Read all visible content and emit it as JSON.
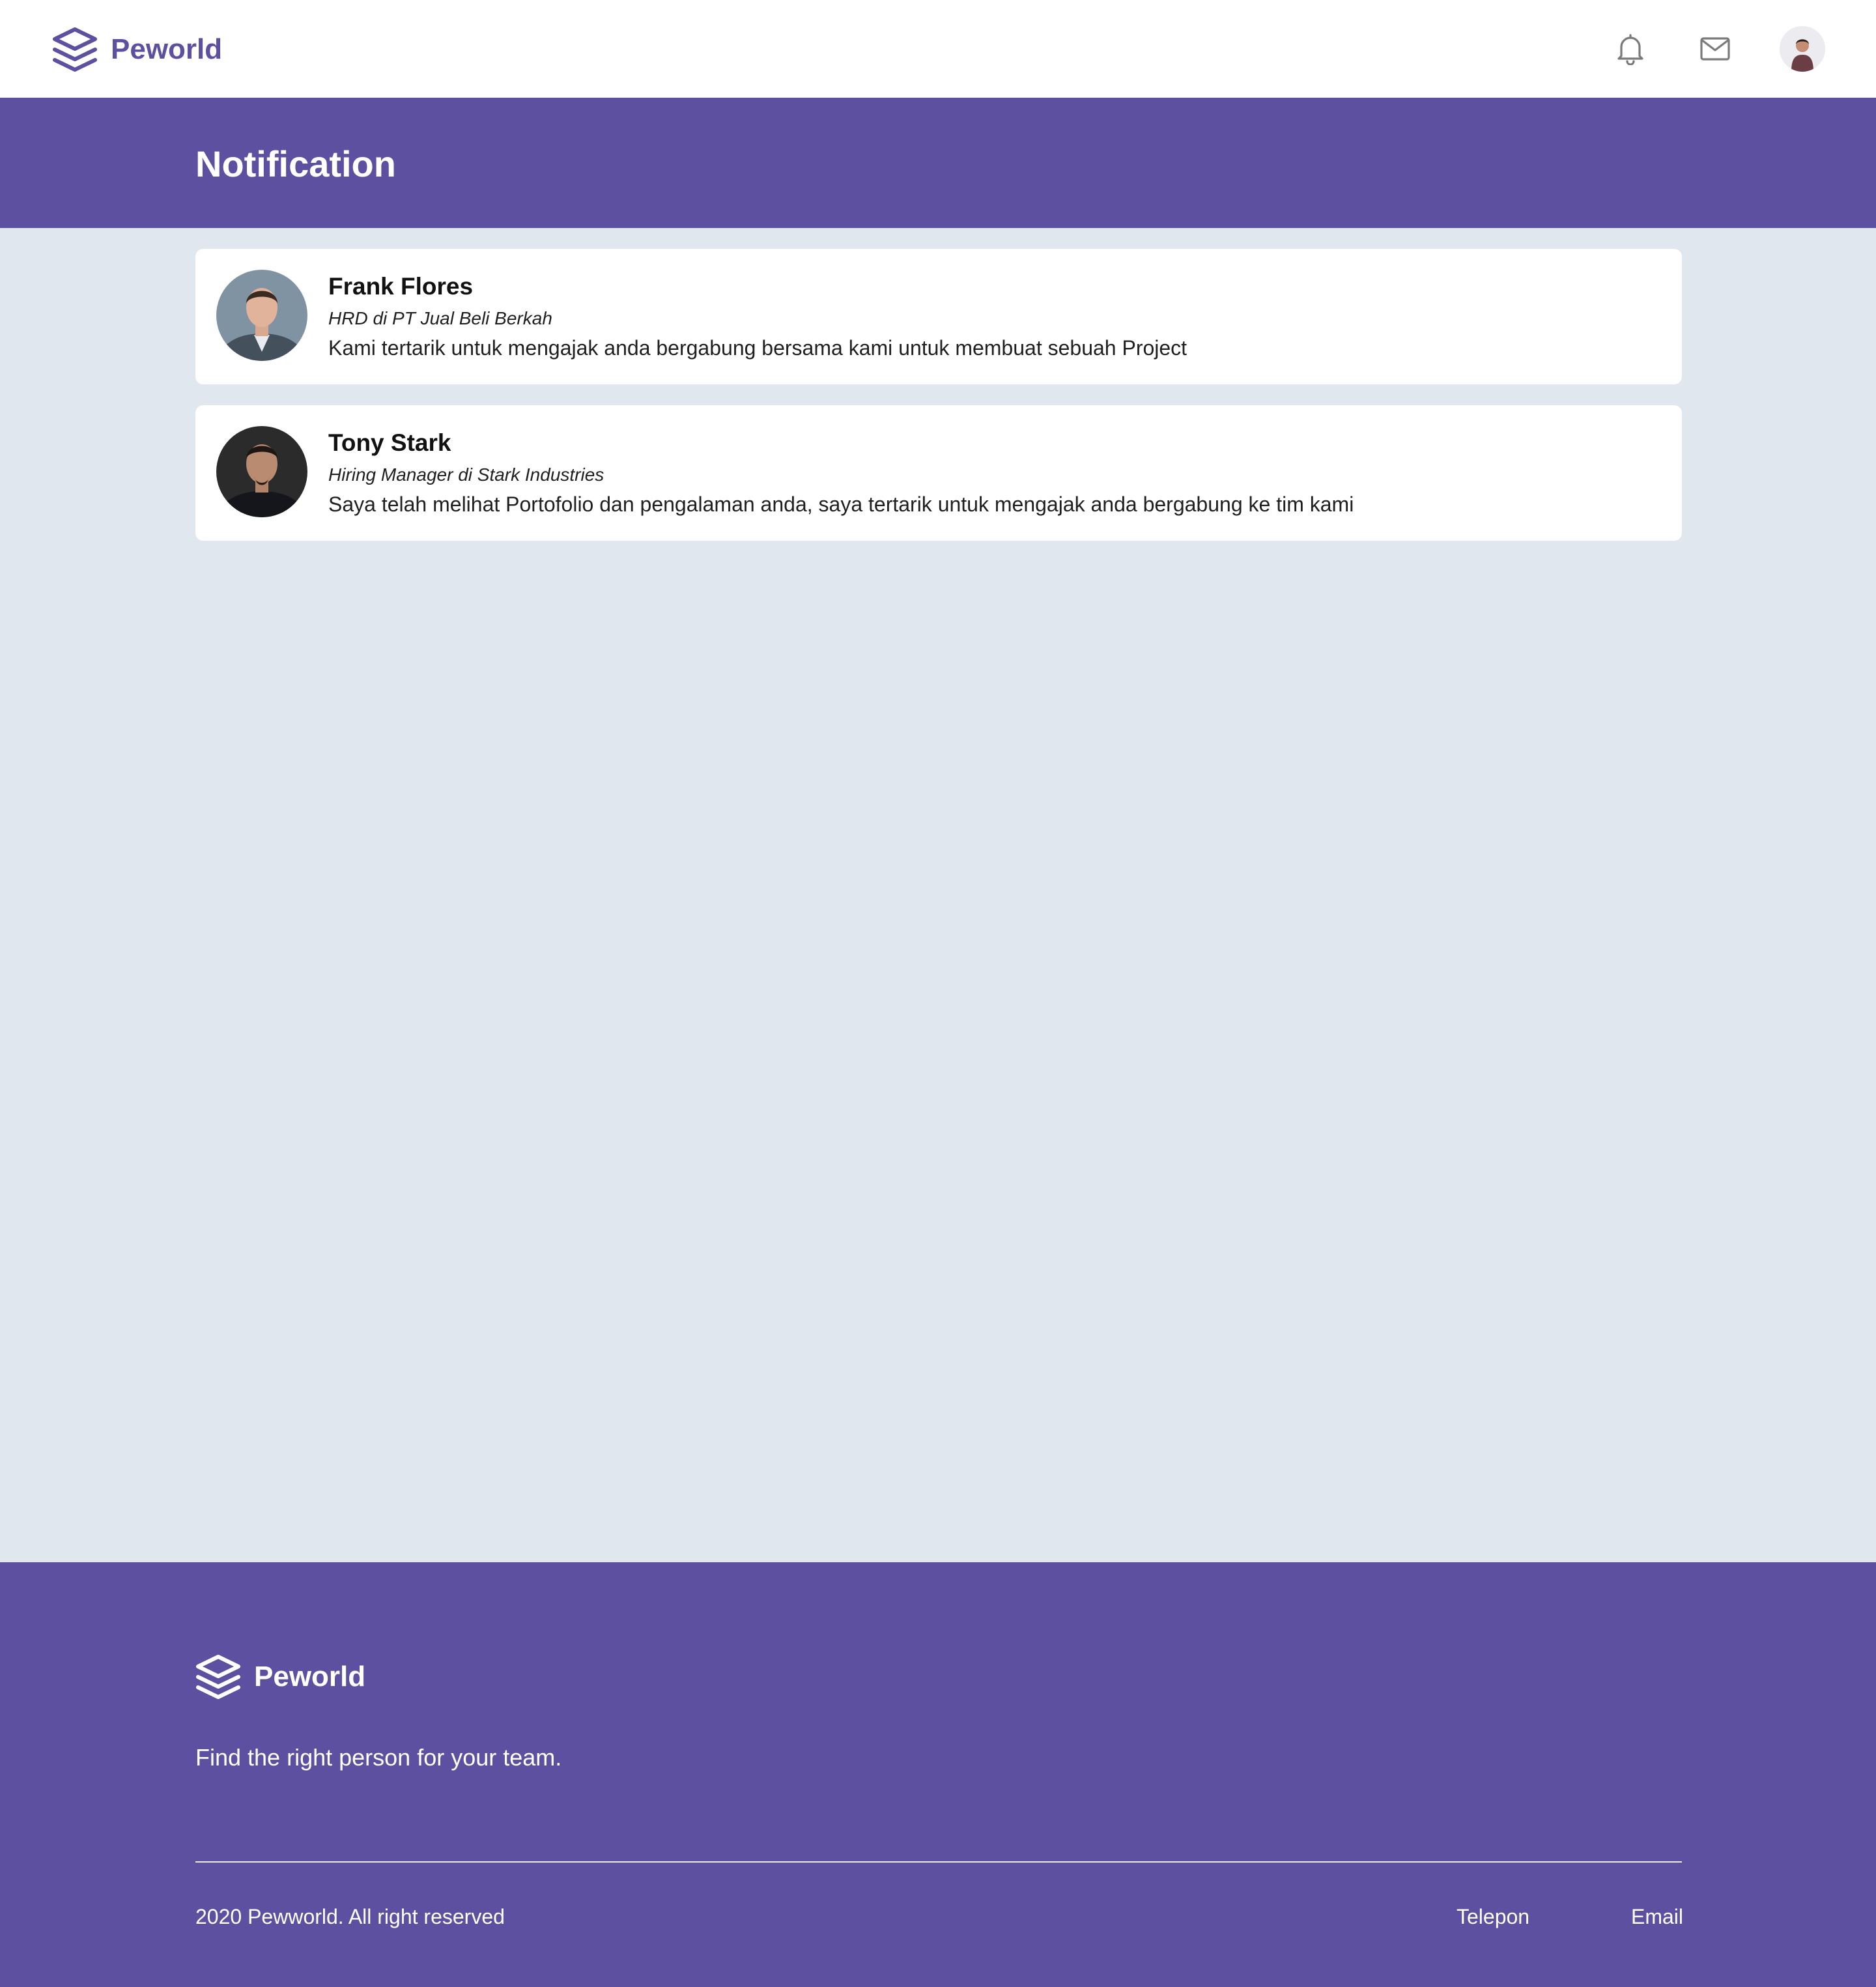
{
  "navbar": {
    "brand": "Peworld",
    "icons": [
      "layers-logo-icon",
      "bell-icon",
      "mail-icon",
      "user-avatar"
    ]
  },
  "header": {
    "title": "Notification"
  },
  "notifications": [
    {
      "name": "Frank Flores",
      "role": "HRD di PT Jual Beli Berkah",
      "message": "Kami tertarik untuk mengajak anda bergabung bersama kami untuk membuat sebuah Project"
    },
    {
      "name": "Tony Stark",
      "role": "Hiring Manager di Stark Industries",
      "message": "Saya telah melihat Portofolio dan pengalaman anda, saya tertarik untuk mengajak anda bergabung ke tim kami"
    }
  ],
  "footer": {
    "brand": "Peworld",
    "tagline": "Find the right person for your team.",
    "copyright": "2020 Pewworld. All right reserved",
    "links": [
      "Telepon",
      "Email"
    ]
  },
  "colors": {
    "brand": "#5e50a1",
    "page_background": "#e1e7ef",
    "card_background": "#ffffff"
  }
}
